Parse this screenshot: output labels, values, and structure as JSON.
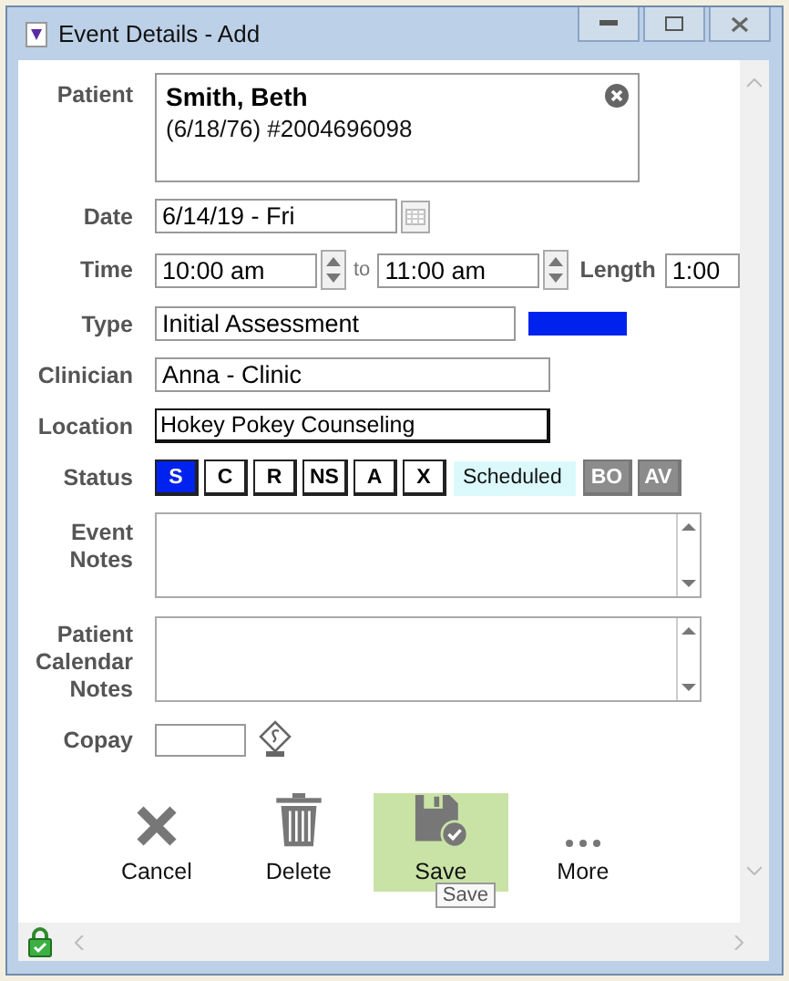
{
  "window": {
    "title": "Event Details - Add"
  },
  "patient": {
    "label": "Patient",
    "name": "Smith, Beth",
    "details": "(6/18/76) #2004696098"
  },
  "date": {
    "label": "Date",
    "value": "6/14/19 - Fri"
  },
  "time": {
    "label": "Time",
    "start": "10:00 am",
    "separator": "to",
    "end": "11:00 am",
    "length_label": "Length",
    "length": "1:00"
  },
  "type": {
    "label": "Type",
    "value": "Initial Assessment",
    "color": "#0022ee"
  },
  "clinician": {
    "label": "Clinician",
    "value": "Anna - Clinic"
  },
  "location": {
    "label": "Location",
    "value": "Hokey Pokey Counseling"
  },
  "status": {
    "label": "Status",
    "text": "Scheduled",
    "options": [
      {
        "label": "S",
        "selected": true,
        "disabled": false
      },
      {
        "label": "C",
        "selected": false,
        "disabled": false
      },
      {
        "label": "R",
        "selected": false,
        "disabled": false
      },
      {
        "label": "NS",
        "selected": false,
        "disabled": false
      },
      {
        "label": "A",
        "selected": false,
        "disabled": false
      },
      {
        "label": "X",
        "selected": false,
        "disabled": false
      }
    ],
    "extras": [
      {
        "label": "BO",
        "disabled": true
      },
      {
        "label": "AV",
        "disabled": true
      }
    ]
  },
  "notes": [
    {
      "label": "Event Notes"
    },
    {
      "label": "Patient Calendar Notes"
    }
  ],
  "copay": {
    "label": "Copay"
  },
  "actions": [
    {
      "kind": "cancel",
      "label": "Cancel",
      "highlighted": false
    },
    {
      "kind": "delete",
      "label": "Delete",
      "highlighted": false
    },
    {
      "kind": "save",
      "label": "Save",
      "highlighted": true
    },
    {
      "kind": "more",
      "label": "More",
      "highlighted": false
    }
  ],
  "tooltip": "Save"
}
